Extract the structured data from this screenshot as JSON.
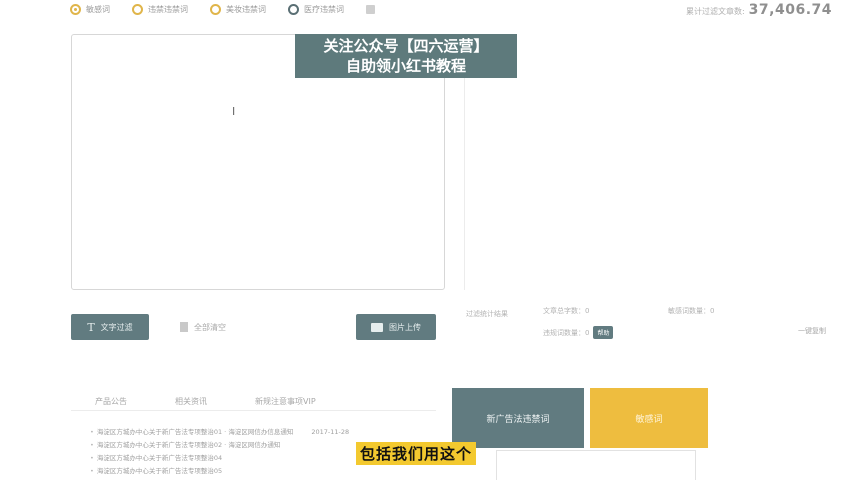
{
  "modes": [
    {
      "label": "敏感词",
      "checked": true,
      "style": "gold"
    },
    {
      "label": "违禁违禁词",
      "checked": false,
      "style": "gold"
    },
    {
      "label": "美妆违禁词",
      "checked": false,
      "style": "gold"
    },
    {
      "label": "医疗违禁词",
      "checked": false,
      "style": "dark"
    }
  ],
  "total": {
    "label": "累计过滤文章数:",
    "value": "37,406.74"
  },
  "editor": {
    "cursor": "I"
  },
  "notice": {
    "line1": "关注公众号【四六运营】",
    "line2": "自助领小红书教程"
  },
  "actions": {
    "filter_label": "文字过滤",
    "clear_label": "全部清空",
    "upload_label": "图片上传"
  },
  "stats": {
    "title": "过滤统计结果",
    "word_count": "文章总字数：0",
    "sensitive_count": "敏感词数量：0",
    "hit_count": "违规词数量：0",
    "help_label": "帮助",
    "copy_label": "一键复制"
  },
  "tabs": [
    "产品公告",
    "相关资讯",
    "新规注意事项VIP"
  ],
  "news": [
    {
      "text": "海淀区方城办中心关于新广告法专项整治01 · 海淀区网信办信息通知",
      "date": "2017-11-28"
    },
    {
      "text": "海淀区方城办中心关于新广告法专项整治02 · 海淀区网信办通知",
      "date": ""
    },
    {
      "text": "海淀区方城办中心关于新广告法专项整治04",
      "date": ""
    },
    {
      "text": "海淀区方城办中心关于新广告法专项整治05",
      "date": ""
    }
  ],
  "cards": {
    "green_label": "新广告法违禁词",
    "yellow_label": "敏感词"
  },
  "subtitle": "包括我们用这个",
  "colors": {
    "accent_gold": "#e0b54a",
    "teal": "#617b80",
    "yellow": "#eebd3f"
  }
}
